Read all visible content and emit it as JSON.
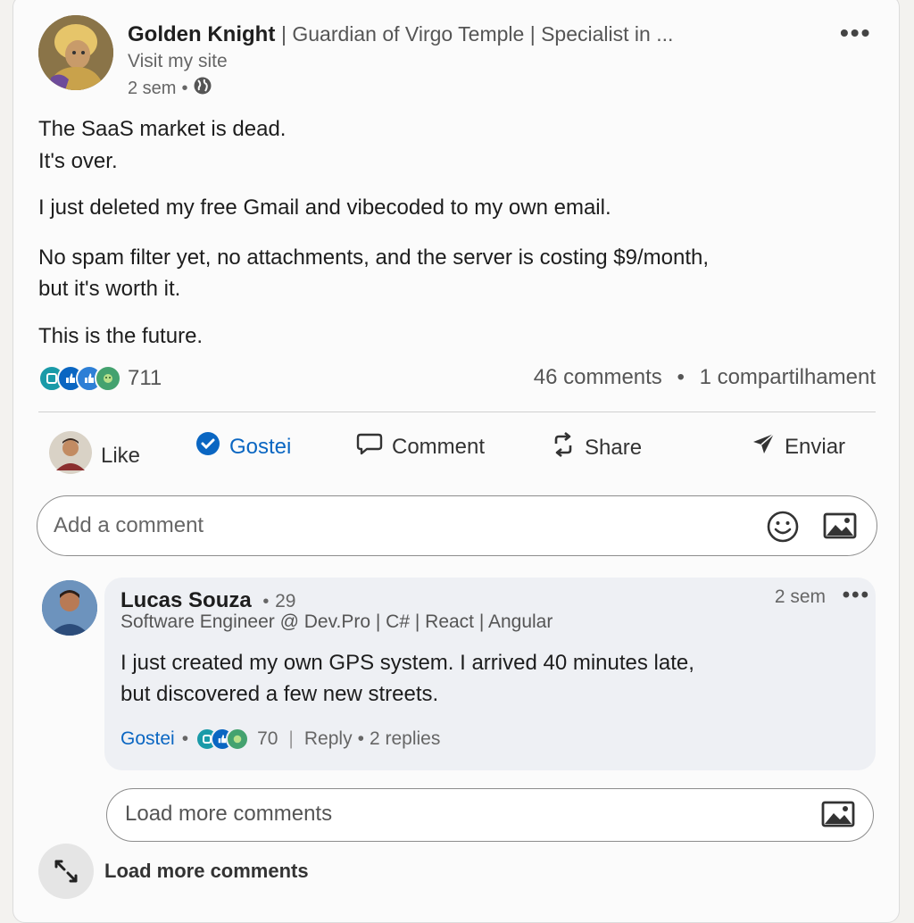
{
  "post": {
    "author_name": "Golden Knight",
    "author_headline": "| Guardian of Virgo Temple | Specialist in ...",
    "visit_link": "Visit my site",
    "time": "2 sem",
    "separator": "•",
    "lines": [
      "The SaaS market is dead.",
      "It's over.",
      "I just deleted my free Gmail and vibecoded to my own email.",
      "No spam filter yet, no attachments, and the server is costing $9/month,",
      "but it's worth it.",
      "This is the future."
    ],
    "reactions_count": "711",
    "comments_count": "46 comments",
    "shares": "1 compartilhament"
  },
  "actions": {
    "like": "Like",
    "gostei": "Gostei",
    "comment": "Comment",
    "share": "Share",
    "send": "Enviar"
  },
  "comment_input": {
    "placeholder": "Add a comment"
  },
  "comment": {
    "author": "Lucas Souza",
    "degree": "29",
    "headline": "Software Engineer @ Dev.Pro | C# | React | Angular",
    "time": "2 sem",
    "lines": [
      "I just created my own GPS system. I arrived 40 minutes late,",
      "but discovered a few new streets."
    ],
    "gostei": "Gostei",
    "reactions": "70",
    "reply": "Reply",
    "replies": "2 replies"
  },
  "load_more_input": "Load more comments",
  "load_more_link": "Load more comments",
  "colors": {
    "accent": "#0a66c2",
    "celebrate": "#44a26f",
    "insightful": "#1a9aa8"
  },
  "icons": [
    "more-dots-icon",
    "globe-icon",
    "smile-icon",
    "image-icon",
    "comment-icon",
    "share-icon",
    "send-icon",
    "expand-icon"
  ]
}
